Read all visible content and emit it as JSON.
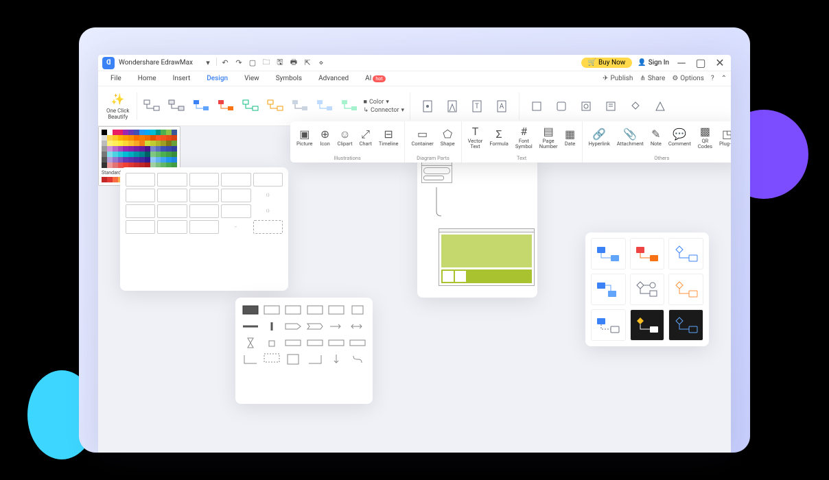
{
  "app": {
    "title": "Wondershare EdrawMax",
    "buy_now": "Buy Now",
    "sign_in": "Sign In"
  },
  "menus": {
    "file": "File",
    "home": "Home",
    "insert": "Insert",
    "design": "Design",
    "view": "View",
    "symbols": "Symbols",
    "advanced": "Advanced",
    "ai": "AI",
    "hot": "hot",
    "publish": "Publish",
    "share": "Share",
    "options": "Options"
  },
  "ribbon": {
    "one_click_beautify": "One Click\nBeautify",
    "color": "Color",
    "connector": "Connector"
  },
  "ribbon2": {
    "groups": {
      "illustrations": "Illustrations",
      "diagram_parts": "Diagram Parts",
      "text": "Text",
      "others": "Others"
    },
    "picture": "Picture",
    "icon": "Icon",
    "clipart": "Clipart",
    "chart": "Chart",
    "timeline": "Timeline",
    "container": "Container",
    "shape": "Shape",
    "vector_text": "Vector\nText",
    "formula": "Formula",
    "font_symbol": "Font\nSymbol",
    "page_number": "Page\nNumber",
    "date": "Date",
    "hyperlink": "Hyperlink",
    "attachment": "Attachment",
    "note": "Note",
    "comment": "Comment",
    "qr_codes": "QR\nCodes",
    "plug_in": "Plug-in"
  },
  "colors_panel": {
    "standard": "Standard Colors"
  },
  "color_palette_main": [
    [
      "#000000",
      "#ffffff",
      "#e91e63",
      "#e91e63",
      "#9c27b0",
      "#673ab7",
      "#3f51b5",
      "#2196f3",
      "#03a9f4",
      "#00bcd4",
      "#009688",
      "#4caf50",
      "#8bc34a",
      "#3b5998"
    ],
    [
      "#dddddd",
      "#ffd54f",
      "#ffca28",
      "#ffb300",
      "#ffa000",
      "#ff8f00",
      "#ff6f00",
      "#f57c00",
      "#ef6c00",
      "#e65100",
      "#ff5722",
      "#f4511e",
      "#e64a19",
      "#d84315"
    ],
    [
      "#bbbbbb",
      "#fff176",
      "#ffee58",
      "#ffeb3b",
      "#fdd835",
      "#fbc02d",
      "#f9a825",
      "#f57f17",
      "#cddc39",
      "#c0ca33",
      "#afb42b",
      "#9e9d24",
      "#827717",
      "#689f38"
    ],
    [
      "#999999",
      "#ce93d8",
      "#ba68c8",
      "#ab47bc",
      "#9c27b0",
      "#8e24aa",
      "#7b1fa2",
      "#6a1b9a",
      "#4a148c",
      "#7986cb",
      "#5c6bc0",
      "#3f51b5",
      "#3949ab",
      "#303f9f"
    ],
    [
      "#777777",
      "#80deea",
      "#4dd0e1",
      "#26c6da",
      "#00bcd4",
      "#00acc1",
      "#0097a7",
      "#00838f",
      "#006064",
      "#81c784",
      "#66bb6a",
      "#4caf50",
      "#43a047",
      "#388e3c"
    ],
    [
      "#555555",
      "#b39ddb",
      "#9575cd",
      "#7e57c2",
      "#673ab7",
      "#5e35b1",
      "#512da8",
      "#4527a0",
      "#311b92",
      "#90caf9",
      "#64b5f6",
      "#42a5f5",
      "#2196f3",
      "#1e88e5"
    ],
    [
      "#333333",
      "#ef9a9a",
      "#e57373",
      "#ef5350",
      "#f44336",
      "#e53935",
      "#d32f2f",
      "#c62828",
      "#b71c1c",
      "#a5d6a7",
      "#81c784",
      "#66bb6a",
      "#4caf50",
      "#43a047"
    ]
  ],
  "color_palette_standard": [
    [
      "#c62828",
      "#e53935",
      "#ff7043",
      "#ffb74d",
      "#fff176",
      "#aed581",
      "#66bb6a",
      "#26a69a",
      "#42a5f5",
      "#5c6bc0",
      "#7e57c2",
      "#ab47bc",
      "#ec407a",
      "#78909c"
    ]
  ]
}
